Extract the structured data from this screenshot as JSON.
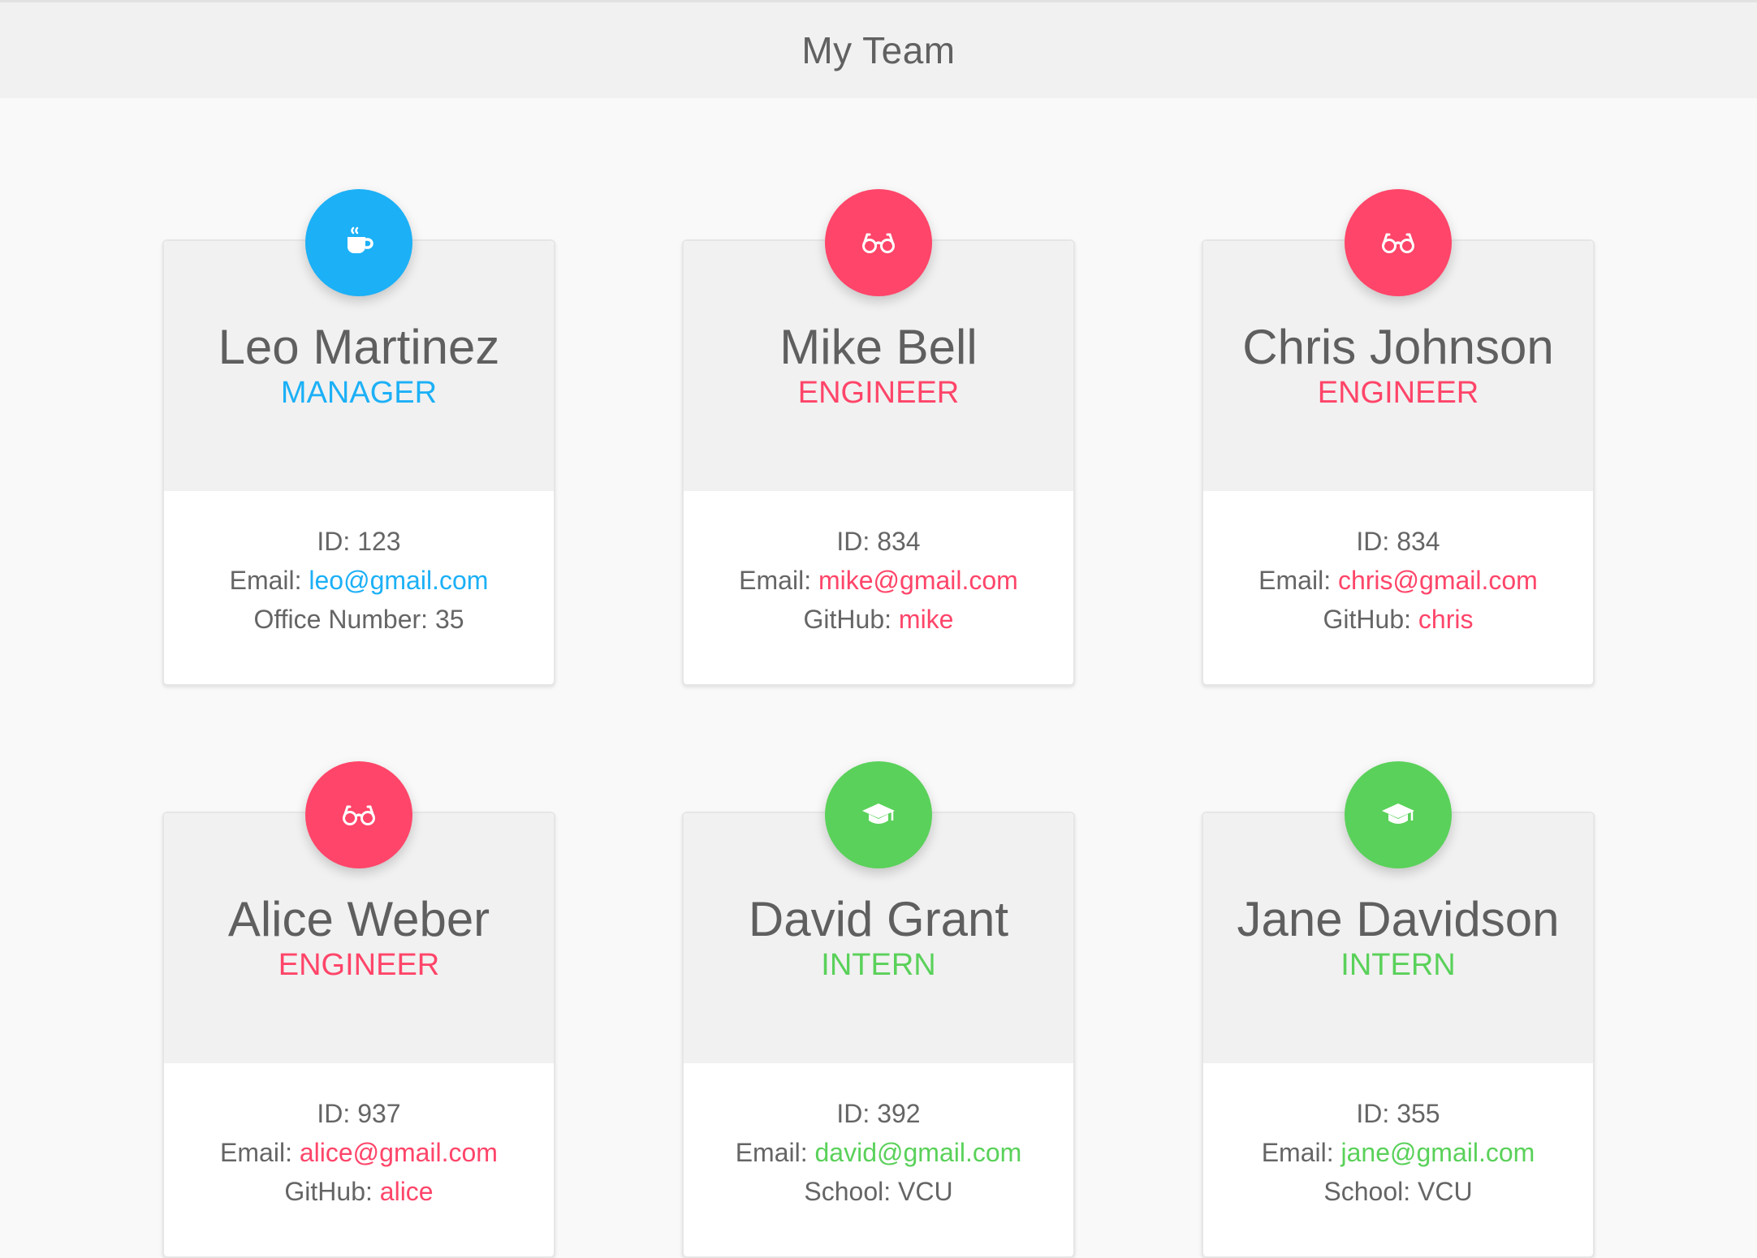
{
  "header": {
    "title": "My Team"
  },
  "colors": {
    "manager": "#1cb0f6",
    "engineer": "#ff4569",
    "intern": "#5ad15a",
    "header_bg": "#f1f1f1",
    "page_bg": "#f9f9f9"
  },
  "team": [
    {
      "name": "Leo Martinez",
      "role": "MANAGER",
      "icon": "coffee-icon",
      "id_label": "ID: ",
      "id": "123",
      "email_label": "Email: ",
      "email": "leo@gmail.com",
      "extra_label": "Office Number: ",
      "extra": "35"
    },
    {
      "name": "Mike Bell",
      "role": "ENGINEER",
      "icon": "glasses-icon",
      "id_label": "ID: ",
      "id": "834",
      "email_label": "Email: ",
      "email": "mike@gmail.com",
      "extra_label": "GitHub: ",
      "extra": "mike"
    },
    {
      "name": "Chris Johnson",
      "role": "ENGINEER",
      "icon": "glasses-icon",
      "id_label": "ID: ",
      "id": "834",
      "email_label": "Email: ",
      "email": "chris@gmail.com",
      "extra_label": "GitHub: ",
      "extra": "chris"
    },
    {
      "name": "Alice Weber",
      "role": "ENGINEER",
      "icon": "glasses-icon",
      "id_label": "ID: ",
      "id": "937",
      "email_label": "Email: ",
      "email": "alice@gmail.com",
      "extra_label": "GitHub: ",
      "extra": "alice"
    },
    {
      "name": "David Grant",
      "role": "INTERN",
      "icon": "graduation-cap-icon",
      "id_label": "ID: ",
      "id": "392",
      "email_label": "Email: ",
      "email": "david@gmail.com",
      "extra_label": "School: ",
      "extra": "VCU"
    },
    {
      "name": "Jane Davidson",
      "role": "INTERN",
      "icon": "graduation-cap-icon",
      "id_label": "ID: ",
      "id": "355",
      "email_label": "Email: ",
      "email": "jane@gmail.com",
      "extra_label": "School: ",
      "extra": "VCU"
    }
  ]
}
